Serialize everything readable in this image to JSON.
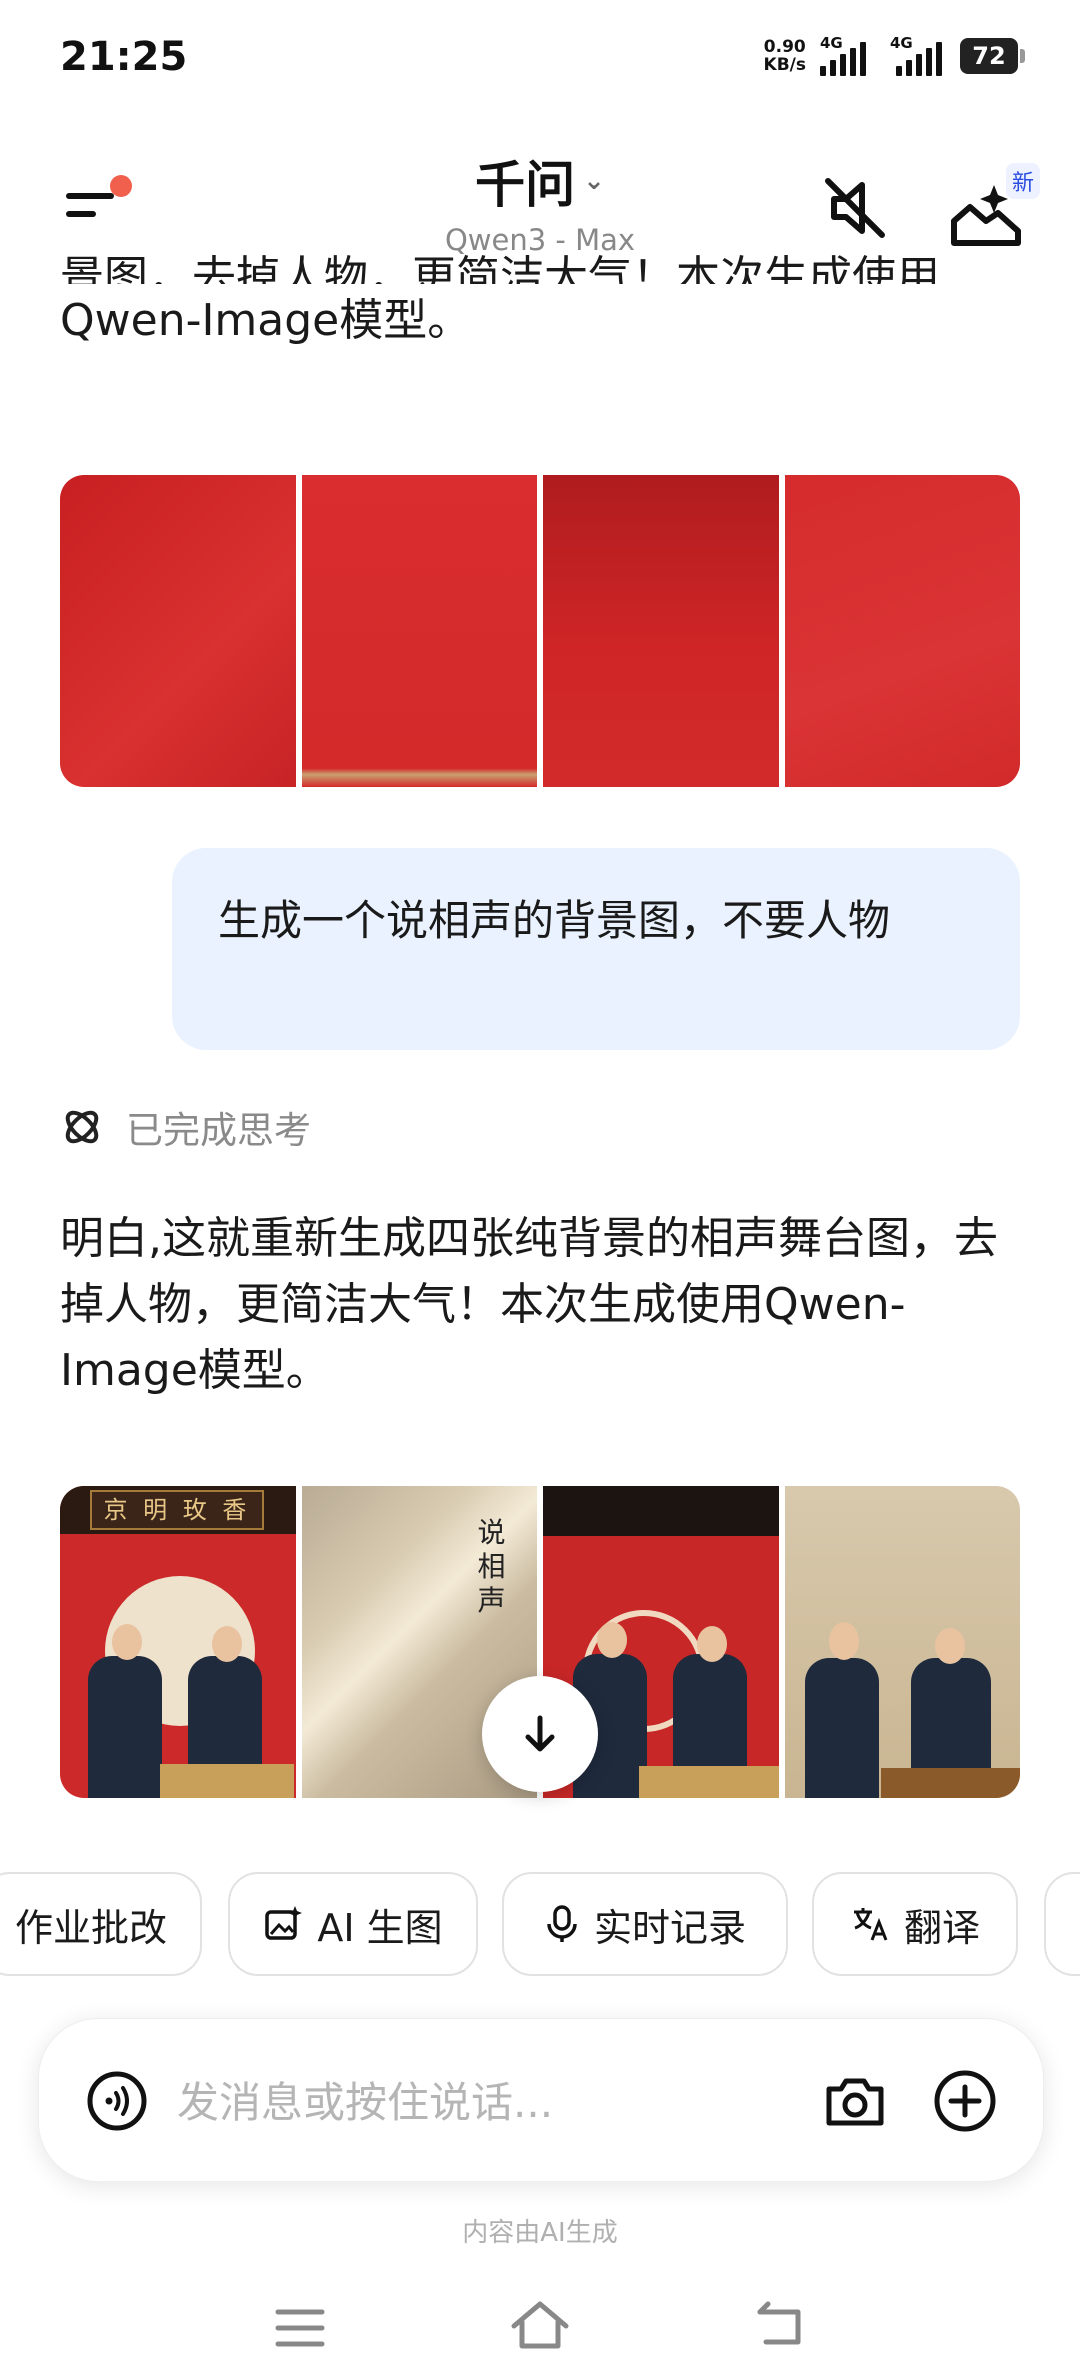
{
  "status_bar": {
    "time": "21:25",
    "net_speed_value": "0.90",
    "net_speed_unit": "KB/s",
    "signal1_label": "4G",
    "signal2_label": "4G",
    "battery": "72"
  },
  "header": {
    "title": "千问",
    "model": "Qwen3 - Max",
    "new_badge": "新"
  },
  "chat": {
    "prev_text_partial": "景图，去掉人物，更简洁大气！本次生成使用",
    "prev_text_line2": "Qwen-Image模型。",
    "user_message": "生成一个说相声的背景图，不要人物",
    "thinking_label": "已完成思考",
    "assistant_text": "明白,这就重新生成四张纯背景的相声舞台图，去掉人物，更简洁大气！本次生成使用Qwen-Image模型。",
    "image2_sign": "京 明 玫 香",
    "image2_vertical": "说相声"
  },
  "chips": [
    {
      "label": "作业批改",
      "icon": ""
    },
    {
      "label": "AI 生图",
      "icon": "image-sparkle-icon"
    },
    {
      "label": "实时记录",
      "icon": "microphone-icon"
    },
    {
      "label": "翻译",
      "icon": "translate-icon"
    }
  ],
  "input": {
    "placeholder": "发消息或按住说话..."
  },
  "footer_note": "内容由AI生成",
  "colors": {
    "accent_dot": "#f0604d",
    "bubble_bg": "#e9f2fe",
    "stage_red": "#d42a2a"
  }
}
